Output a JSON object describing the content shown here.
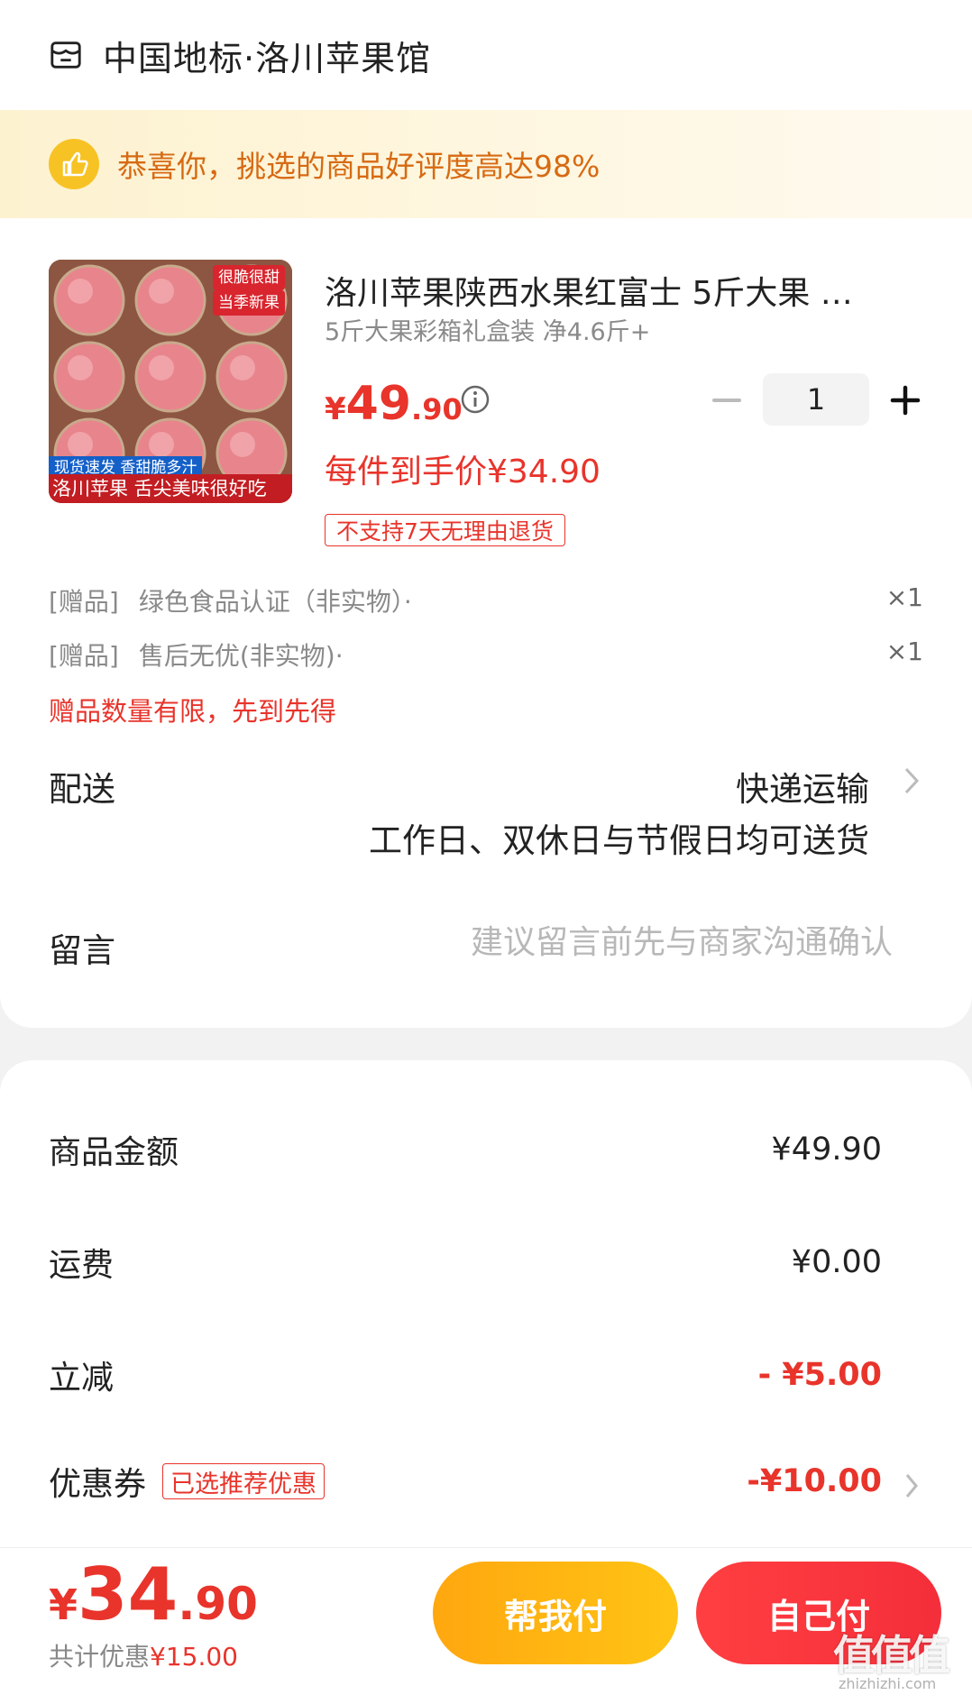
{
  "shop": {
    "name": "中国地标·洛川苹果馆",
    "icon": "store-icon"
  },
  "praise": {
    "text": "恭喜你，挑选的商品好评度高达98%",
    "icon": "thumbs-up-icon"
  },
  "product": {
    "image_tags": {
      "top": "很脆很甜",
      "mid": "当季新果",
      "band1": "现货速发 香甜脆多汁",
      "band2": "洛川苹果 舌尖美味很好吃"
    },
    "title": "洛川苹果陕西水果红富士 5斤大果 …",
    "spec": "5斤大果彩箱礼盒装 净4.6斤+",
    "price": {
      "currency": "¥",
      "integer": "49",
      "decimal": ".90"
    },
    "quantity": "1",
    "unit_price": "每件到手价¥34.90",
    "no_return": "不支持7天无理由退货"
  },
  "gifts": [
    {
      "tag": "[赠品]",
      "name": "绿色食品认证（非实物）·",
      "qty": "×1"
    },
    {
      "tag": "[赠品]",
      "name": "售后无优(非实物)·",
      "qty": "×1"
    }
  ],
  "gift_note": "赠品数量有限，先到先得",
  "delivery": {
    "label": "配送",
    "method": "快递运输",
    "note": "工作日、双休日与节假日均可送货"
  },
  "message": {
    "label": "留言",
    "placeholder": "建议留言前先与商家沟通确认",
    "value": ""
  },
  "summary": [
    {
      "label": "商品金额",
      "value": "¥49.90"
    },
    {
      "label": "运费",
      "value": "¥0.00"
    },
    {
      "label": "立减",
      "value": "- ¥5.00"
    },
    {
      "label": "优惠券",
      "tag": "已选推荐优惠",
      "value": "-¥10.00"
    }
  ],
  "footer": {
    "total": {
      "currency": "¥",
      "integer": "34",
      "decimal": ".90"
    },
    "discount_label": "共计优惠",
    "discount_value": "¥15.00",
    "help_pay": "帮我付",
    "self_pay": "自己付"
  },
  "watermark": {
    "text": "值值值",
    "url": "zhizhizhi.com"
  },
  "colors": {
    "accent": "#e8342b",
    "praise_text": "#d76a12",
    "help_btn": "#ffb312",
    "pay_btn": "#f83a3e"
  }
}
